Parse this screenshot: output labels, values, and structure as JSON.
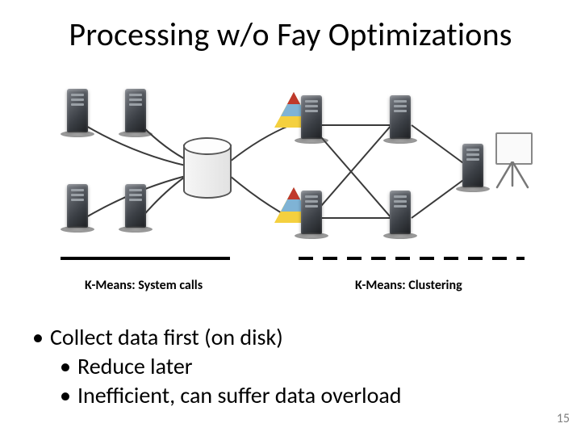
{
  "title": "Processing w/o Fay Optimizations",
  "stages": {
    "left": "K-Means: System calls",
    "right": "K-Means: Clustering"
  },
  "bullets": {
    "main": "Collect data first (on disk)",
    "sub1": "Reduce later",
    "sub2": "Inefficient, can suffer data overload"
  },
  "page_number": "15",
  "diagram": {
    "left_servers": 4,
    "center_store": "cylinder-database",
    "middle_nodes": [
      "pyramid-server",
      "pyramid-server"
    ],
    "right_nodes": [
      "server",
      "server"
    ],
    "sink_nodes": [
      "server",
      "whiteboard"
    ]
  },
  "chart_data": {
    "type": "diagram",
    "description": "Data-flow pipeline without Fay optimizations",
    "stages": [
      {
        "name": "K-Means: System calls",
        "style": "solid",
        "nodes": [
          {
            "id": "S1",
            "kind": "server"
          },
          {
            "id": "S2",
            "kind": "server"
          },
          {
            "id": "S3",
            "kind": "server"
          },
          {
            "id": "S4",
            "kind": "server"
          },
          {
            "id": "DB",
            "kind": "disk-store"
          }
        ],
        "edges": [
          [
            "S1",
            "DB"
          ],
          [
            "S2",
            "DB"
          ],
          [
            "S3",
            "DB"
          ],
          [
            "S4",
            "DB"
          ]
        ]
      },
      {
        "name": "K-Means: Clustering",
        "style": "dashed",
        "nodes": [
          {
            "id": "P1",
            "kind": "pyramid-server"
          },
          {
            "id": "P2",
            "kind": "pyramid-server"
          },
          {
            "id": "R1",
            "kind": "server"
          },
          {
            "id": "R2",
            "kind": "server"
          },
          {
            "id": "SK",
            "kind": "server"
          },
          {
            "id": "WB",
            "kind": "whiteboard"
          }
        ],
        "edges": [
          [
            "DB",
            "P1"
          ],
          [
            "DB",
            "P2"
          ],
          [
            "P1",
            "R1"
          ],
          [
            "P1",
            "R2"
          ],
          [
            "P2",
            "R1"
          ],
          [
            "P2",
            "R2"
          ],
          [
            "R1",
            "SK"
          ],
          [
            "R2",
            "SK"
          ],
          [
            "SK",
            "WB"
          ]
        ]
      }
    ]
  }
}
